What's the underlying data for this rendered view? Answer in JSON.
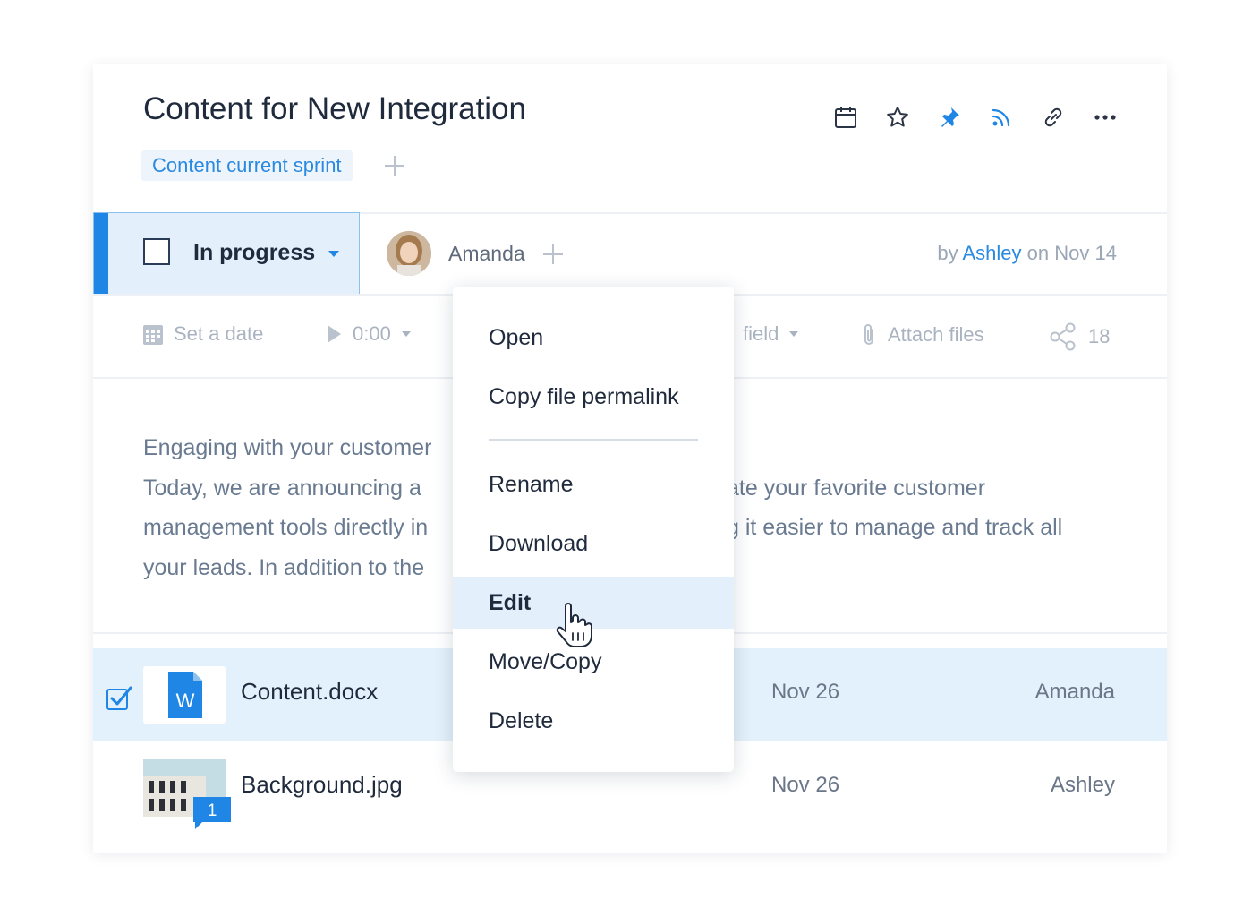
{
  "task": {
    "title": "Content for New Integration",
    "tag": "Content current sprint",
    "status": "In progress",
    "assignee": "Amanda",
    "byline": {
      "prefix": "by",
      "author": "Ashley",
      "middle": "on",
      "date": "Nov 14"
    }
  },
  "header_icons": [
    "calendar-icon",
    "star-icon",
    "pin-icon",
    "rss-icon",
    "link-icon",
    "more-icon"
  ],
  "tools": {
    "date_placeholder": "Set a date",
    "timer": "0:00",
    "field": "field",
    "attach": "Attach files",
    "share_count": "18"
  },
  "description": [
    "Engaging with your customer",
    "Today, we are announcing a",
    "management tools directly in",
    "your leads. In addition to the"
  ],
  "description_right": [
    "",
    "ate your favorite customer",
    "g it easier to manage and track all",
    ""
  ],
  "files": [
    {
      "name": "Content.docx",
      "date": "Nov 26",
      "owner": "Amanda",
      "type_label": "W",
      "selected": true
    },
    {
      "name": "Background.jpg",
      "date": "Nov 26",
      "owner": "Ashley",
      "comments": "1",
      "selected": false
    }
  ],
  "context_menu": {
    "items": [
      "Open",
      "Copy file permalink",
      "Rename",
      "Download",
      "Edit",
      "Move/Copy",
      "Delete"
    ],
    "active": "Edit"
  },
  "colors": {
    "accent": "#1f86e6",
    "selected_bg": "#e3f0fb",
    "text": "#1f2a3d",
    "muted": "#a9b3c0"
  }
}
